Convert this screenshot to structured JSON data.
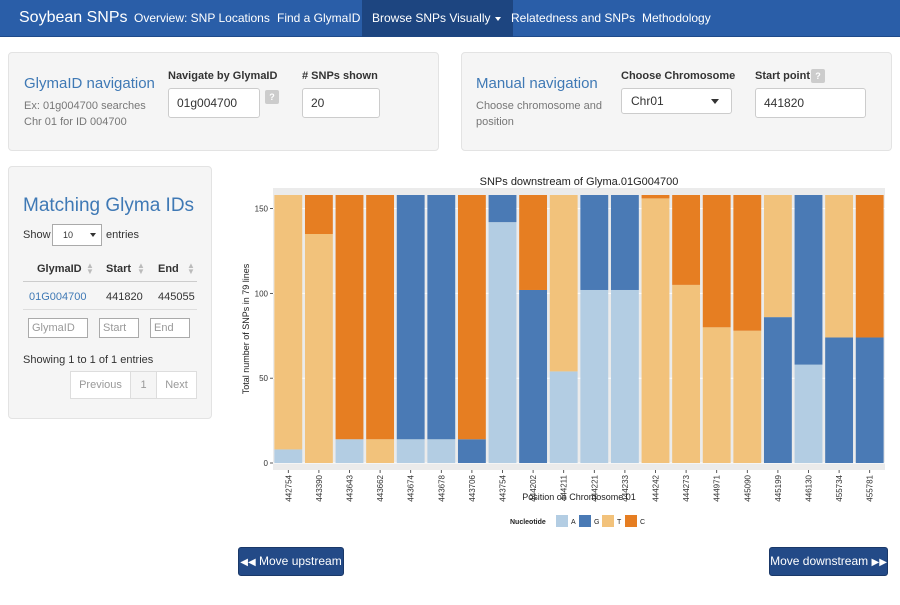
{
  "navbar": {
    "brand": "Soybean SNPs",
    "items": [
      {
        "label": "Overview: SNP Locations"
      },
      {
        "label": "Find a GlymaID"
      },
      {
        "label": "Browse SNPs Visually"
      },
      {
        "label": "Relatedness and SNPs"
      },
      {
        "label": "Methodology"
      }
    ],
    "active_index": 2
  },
  "glyma_nav": {
    "title": "GlymaID navigation",
    "help": "Ex: 01g004700 searches Chr 01 for ID 004700",
    "navigate_label": "Navigate by GlymaID",
    "navigate_value": "01g004700",
    "help_button": "?",
    "snps_label": "# SNPs shown",
    "snps_value": "20"
  },
  "manual_nav": {
    "title": "Manual navigation",
    "help": "Choose chromosome and position",
    "chrom_label": "Choose Chromosome",
    "chrom_value": "Chr01",
    "start_label": "Start point",
    "help_button": "?",
    "start_value": "441820"
  },
  "table": {
    "title": "Matching Glyma IDs",
    "show_prefix": "Show",
    "length_value": "10",
    "show_suffix": "entries",
    "columns": [
      "GlymaID",
      "Start",
      "End"
    ],
    "rows": [
      {
        "id": "01G004700",
        "start": "441820",
        "end": "445055"
      }
    ],
    "filters": [
      "GlymaID",
      "Start",
      "End"
    ],
    "info": "Showing 1 to 1 of 1 entries",
    "pager": {
      "prev": "Previous",
      "page": "1",
      "next": "Next"
    }
  },
  "buttons": {
    "upstream": "Move upstream",
    "downstream": "Move downstream"
  },
  "chart_data": {
    "type": "bar",
    "stacked": true,
    "title": "SNPs downstream of Glyma.01G004700",
    "xlabel": "Position on  Chromosome 01",
    "ylabel": "Total number of SNPs in 79 lines",
    "ylim": [
      0,
      158
    ],
    "yticks": [
      0,
      50,
      100,
      150
    ],
    "legend_title": "Nucleotide",
    "legend_position": "bottom",
    "categories": [
      "442754",
      "443390",
      "443643",
      "443662",
      "443674",
      "443678",
      "443706",
      "443754",
      "444202",
      "444211",
      "444221",
      "444233",
      "444242",
      "444273",
      "444971",
      "445090",
      "445199",
      "446130",
      "455734",
      "455781"
    ],
    "series": [
      {
        "name": "A",
        "color": "#b3cde3",
        "values": [
          8,
          0,
          14,
          0,
          14,
          14,
          0,
          142,
          0,
          54,
          102,
          102,
          0,
          0,
          0,
          0,
          0,
          58,
          0,
          0
        ]
      },
      {
        "name": "G",
        "color": "#4a7ab5",
        "values": [
          0,
          0,
          0,
          0,
          144,
          144,
          14,
          16,
          102,
          0,
          56,
          56,
          0,
          0,
          0,
          0,
          86,
          100,
          74,
          74
        ]
      },
      {
        "name": "T",
        "color": "#f2c27b",
        "values": [
          150,
          135,
          0,
          14,
          0,
          0,
          0,
          0,
          0,
          104,
          0,
          0,
          156,
          105,
          80,
          78,
          72,
          0,
          84,
          0
        ]
      },
      {
        "name": "C",
        "color": "#e67e22",
        "values": [
          0,
          23,
          144,
          144,
          0,
          0,
          144,
          0,
          56,
          0,
          0,
          0,
          2,
          53,
          78,
          80,
          0,
          0,
          0,
          84
        ]
      }
    ]
  }
}
